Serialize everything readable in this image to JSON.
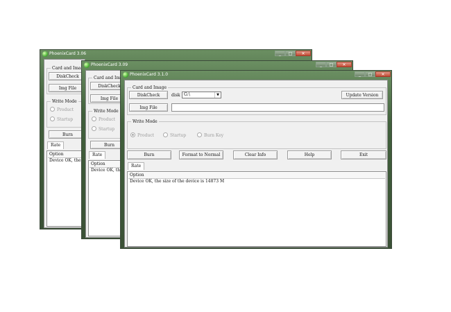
{
  "windows": [
    {
      "title": "PhoenixCard 3.06",
      "controls": [
        "_",
        "□",
        "✕"
      ],
      "card_group_label": "Card and Image",
      "diskcheck_label": "DiskCheck",
      "imgfile_label": "Img File",
      "write_mode_label": "Write Mode",
      "radio_product": "Product",
      "radio_startup": "Startup",
      "burn_label": "Burn",
      "tab_label": "Rate",
      "option_header": "Option",
      "log_line": "Device OK, the"
    },
    {
      "title": "PhoenixCard 3.09",
      "controls": [
        "_",
        "□",
        "✕"
      ],
      "card_group_label": "Card and Image",
      "diskcheck_label": "DiskCheck",
      "imgfile_label": "Img File",
      "write_mode_label": "Write Mode",
      "radio_product": "Product",
      "radio_startup": "Startup",
      "burn_label": "Burn",
      "tab_label": "Rate",
      "option_header": "Option",
      "log_line": "Device OK, the"
    },
    {
      "title": "PhoenixCard 3.1.0",
      "controls": [
        "_",
        "□",
        "✕"
      ],
      "card_group_label": "Card and Image",
      "diskcheck_label": "DiskCheck",
      "disk_label": "disk",
      "disk_value": "G:\\",
      "update_label": "Update Version",
      "imgfile_label": "Img File",
      "write_mode_label": "Write Mode",
      "radio_product": "Product",
      "radio_startup": "Startup",
      "radio_burnkey": "Burn Key",
      "burn_label": "Burn",
      "format_label": "Format to Normal",
      "clear_label": "Clear Info",
      "help_label": "Help",
      "exit_label": "Exit",
      "tab_label": "Rate",
      "option_header": "Option",
      "log_line": "Device OK, the size of the device is 14873 M"
    }
  ]
}
